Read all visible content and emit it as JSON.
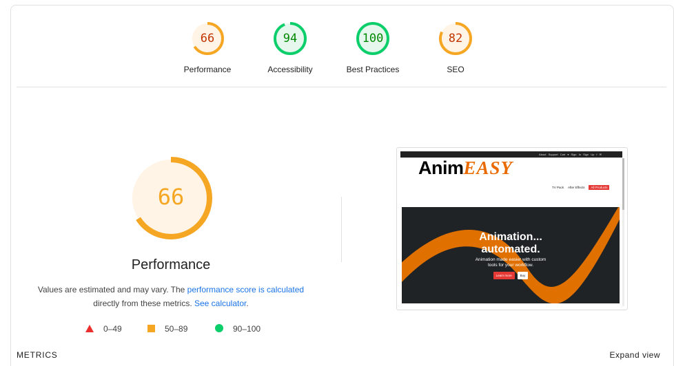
{
  "categories": [
    {
      "score": "66",
      "score_value": 66,
      "label": "Performance",
      "status": "average"
    },
    {
      "score": "94",
      "score_value": 94,
      "label": "Accessibility",
      "status": "pass"
    },
    {
      "score": "100",
      "score_value": 100,
      "label": "Best Practices",
      "status": "pass"
    },
    {
      "score": "82",
      "score_value": 82,
      "label": "SEO",
      "status": "average"
    }
  ],
  "colors": {
    "pass": "#0cce6b",
    "pass_text": "#008800",
    "pass_bg": "#e6f8ee",
    "average": "#f5a623",
    "average_text": "#c33300",
    "average_bg": "#fff4e5",
    "fail": "#eb2f2f",
    "link": "#1a73e8"
  },
  "performance": {
    "score": "66",
    "score_value": 66,
    "title": "Performance",
    "desc_text1": "Values are estimated and may vary. The ",
    "desc_link1": "performance score is calculated",
    "desc_text2": " directly from these metrics. ",
    "desc_link2": "See calculator",
    "desc_text3": "."
  },
  "legend": [
    {
      "icon": "triangle-icon",
      "label": "0–49"
    },
    {
      "icon": "square-icon",
      "label": "50–89"
    },
    {
      "icon": "circle-icon",
      "label": "90–100"
    }
  ],
  "screenshot": {
    "topbar": "About Support Cart ▾ Sign In Sign Up f ✉",
    "logo_part1": "Anim",
    "logo_part2": "EASY",
    "nav": [
      "TV Pack",
      "After Effects",
      "All Products"
    ],
    "hero_title_line1": "Animation...",
    "hero_title_line2": "automated.",
    "hero_sub_line1": "Animation made easier with custom",
    "hero_sub_line2": "tools for your workflow.",
    "btn_primary": "Learn more",
    "btn_secondary": "Buy"
  },
  "footer": {
    "metrics_label": "METRICS",
    "expand_label": "Expand view"
  }
}
